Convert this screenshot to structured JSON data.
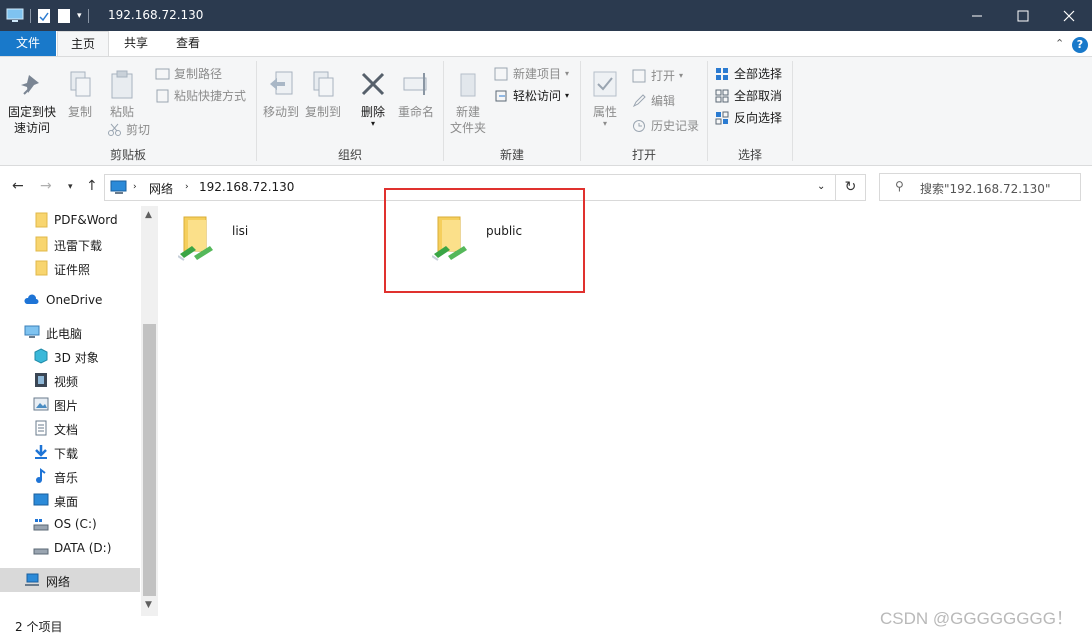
{
  "window": {
    "title": "192.168.72.130"
  },
  "tabs": {
    "file": "文件",
    "home": "主页",
    "share": "共享",
    "view": "查看"
  },
  "ribbon": {
    "clipboard": {
      "label": "剪贴板",
      "pin_line1": "固定到快",
      "pin_line2": "速访问",
      "copy": "复制",
      "paste": "粘贴",
      "copy_path": "复制路径",
      "paste_shortcut": "粘贴快捷方式",
      "cut": "剪切"
    },
    "organize": {
      "label": "组织",
      "move_to": "移动到",
      "copy_to": "复制到",
      "delete": "删除",
      "rename": "重命名"
    },
    "new": {
      "label": "新建",
      "new_folder_line1": "新建",
      "new_folder_line2": "文件夹",
      "new_item": "新建项目",
      "easy_access": "轻松访问"
    },
    "open": {
      "label": "打开",
      "properties": "属性",
      "open": "打开",
      "edit": "编辑",
      "history": "历史记录"
    },
    "select": {
      "label": "选择",
      "select_all": "全部选择",
      "select_none": "全部取消",
      "invert": "反向选择"
    }
  },
  "address": {
    "crumbs": [
      "网络",
      "192.168.72.130"
    ]
  },
  "search": {
    "placeholder": "搜索\"192.168.72.130\""
  },
  "sidebar": {
    "items": [
      {
        "label": "PDF&Word",
        "icon": "folder-icon"
      },
      {
        "label": "迅雷下载",
        "icon": "folder-icon"
      },
      {
        "label": "证件照",
        "icon": "folder-icon"
      },
      {
        "label": "OneDrive",
        "icon": "cloud-icon"
      },
      {
        "label": "此电脑",
        "icon": "computer-icon"
      },
      {
        "label": "3D 对象",
        "icon": "cube-icon"
      },
      {
        "label": "视频",
        "icon": "video-icon"
      },
      {
        "label": "图片",
        "icon": "picture-icon"
      },
      {
        "label": "文档",
        "icon": "document-icon"
      },
      {
        "label": "下载",
        "icon": "download-icon"
      },
      {
        "label": "音乐",
        "icon": "music-icon"
      },
      {
        "label": "桌面",
        "icon": "desktop-icon"
      },
      {
        "label": "OS (C:)",
        "icon": "drive-icon"
      },
      {
        "label": "DATA (D:)",
        "icon": "drive-icon"
      },
      {
        "label": "网络",
        "icon": "network-icon"
      }
    ]
  },
  "content": {
    "folders": [
      "lisi",
      "public"
    ]
  },
  "status": {
    "count": "2 个项目"
  },
  "watermark": "CSDN @GGGGGGGG！",
  "colors": {
    "titlebar": "#2b3a4f",
    "file_tab": "#1979ca",
    "highlight": "#e0312e"
  }
}
